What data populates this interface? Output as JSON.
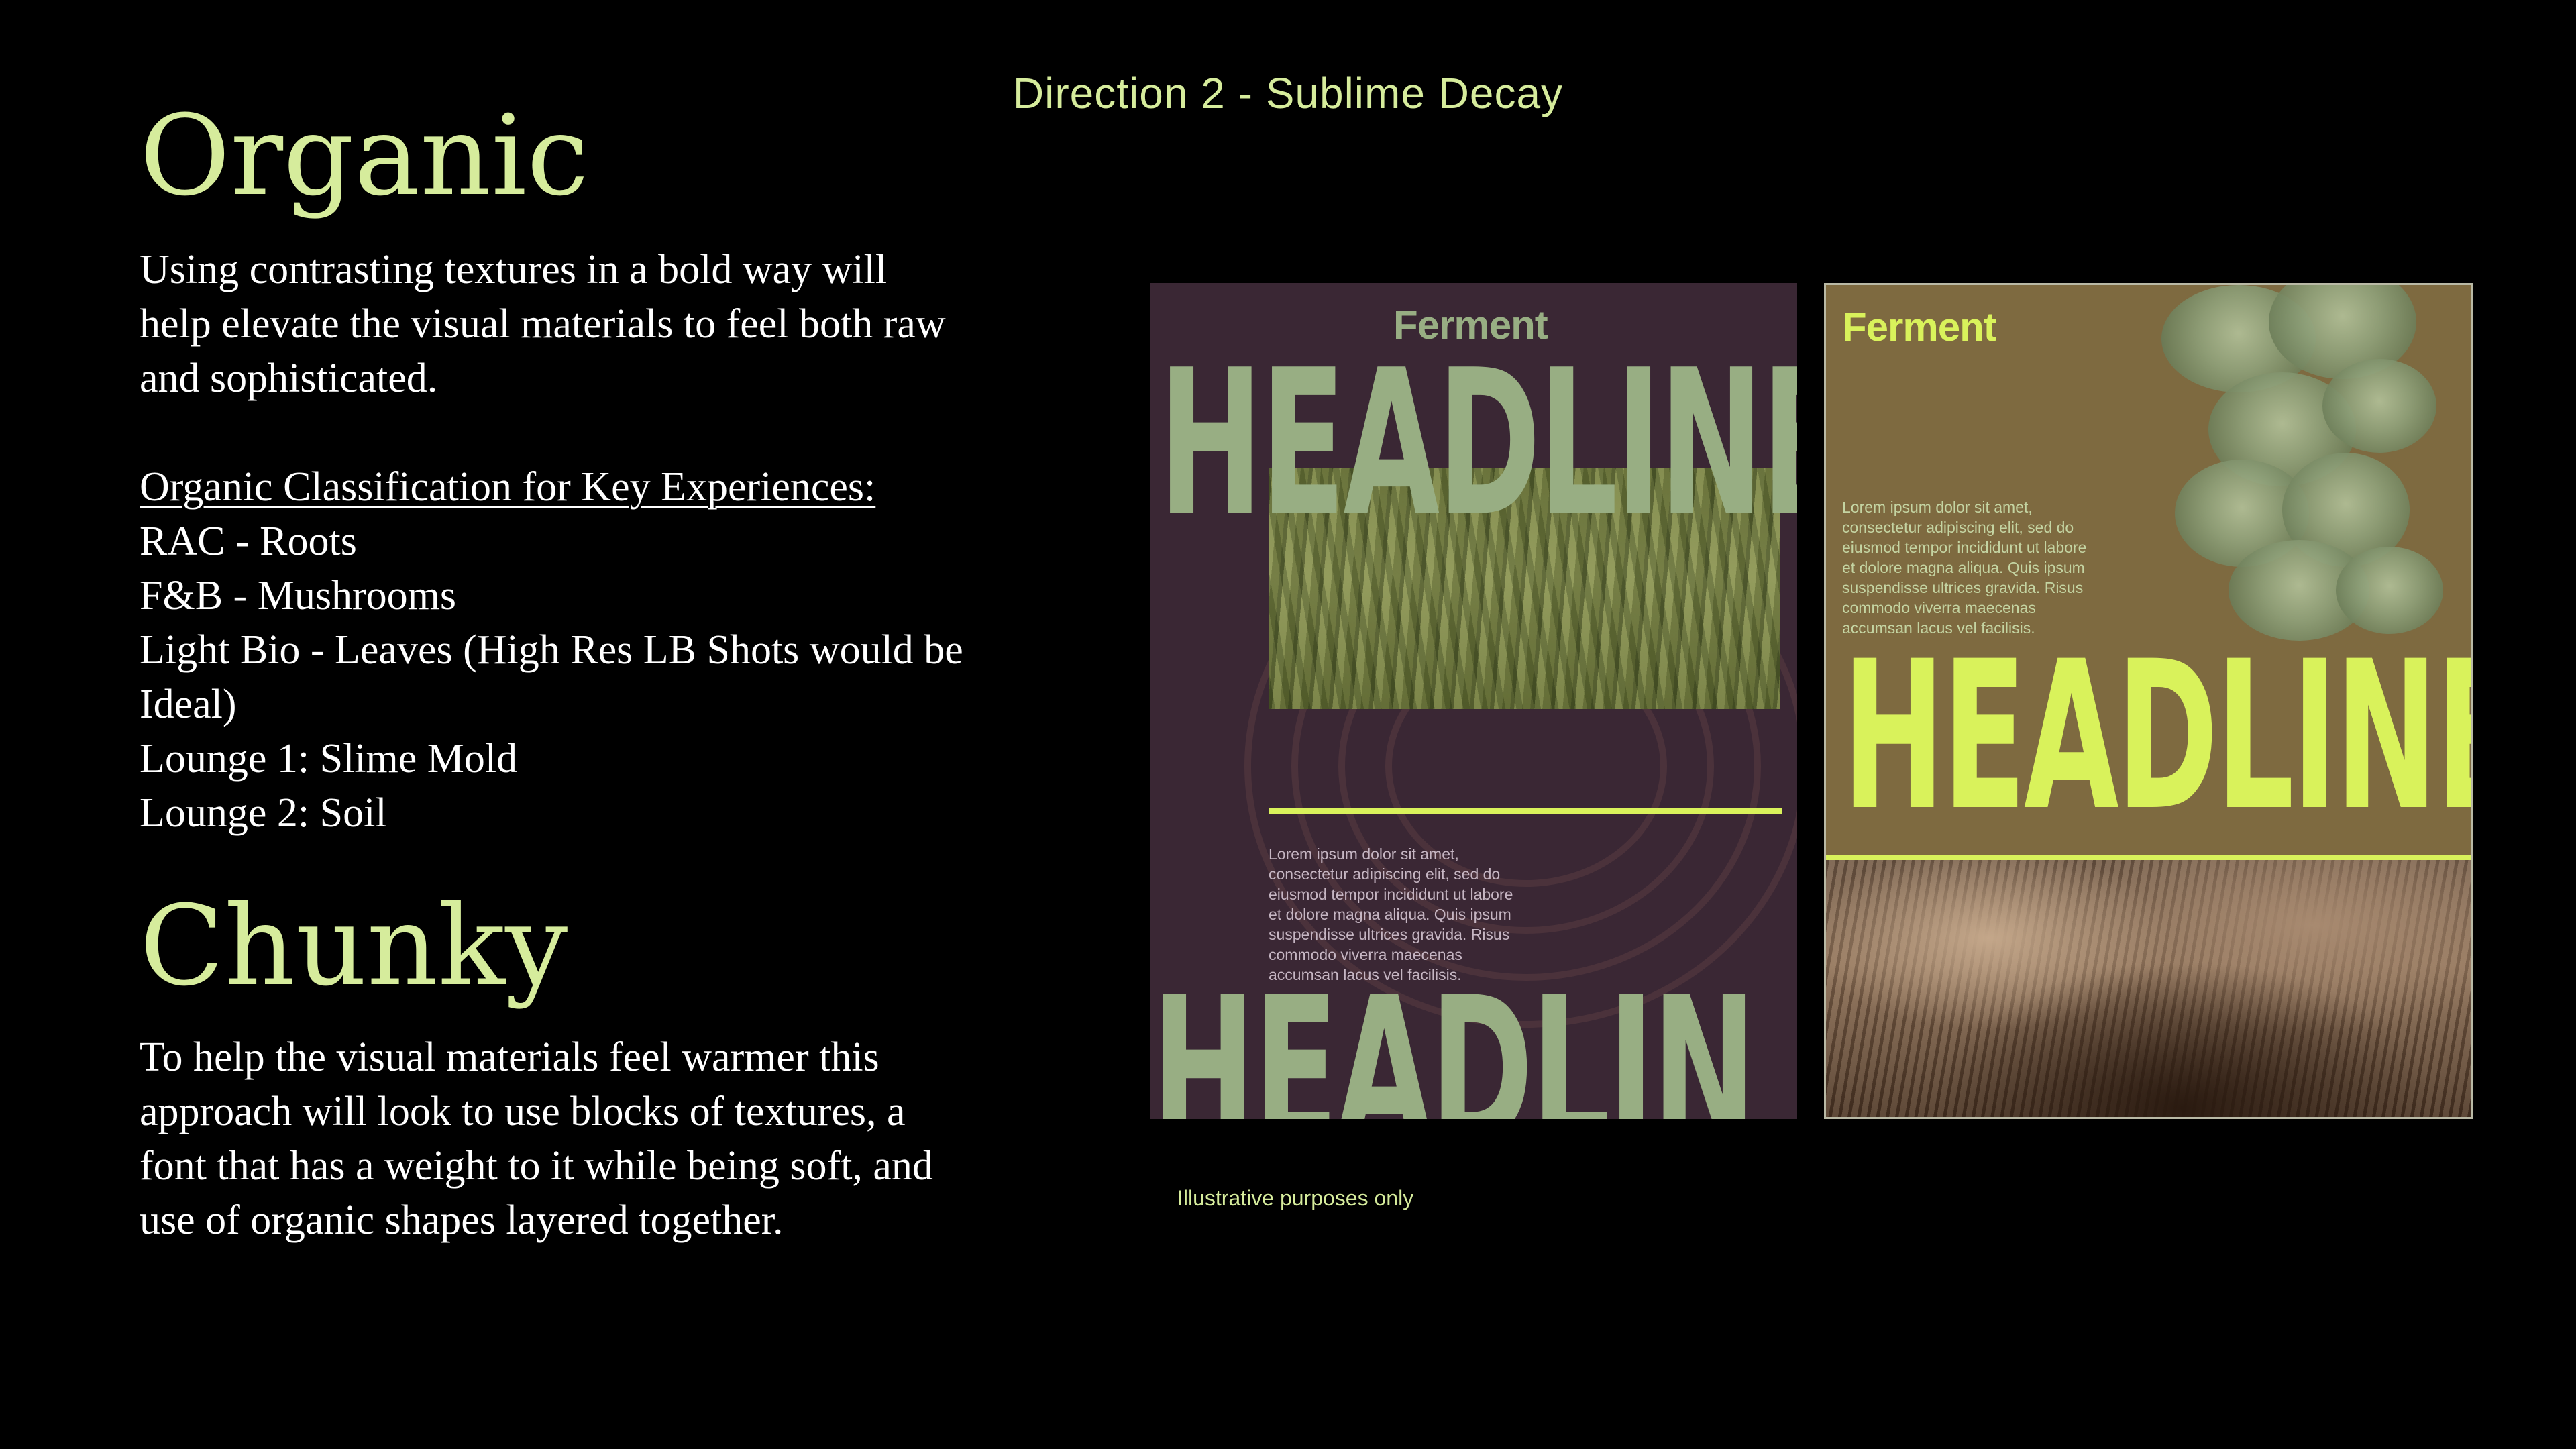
{
  "slide": {
    "direction_title": "Direction 2 - Sublime Decay"
  },
  "organic": {
    "heading": "Organic",
    "body": "Using contrasting textures in a bold way will help elevate the visual materials to feel both raw and sophisticated.",
    "classification": {
      "heading": "Organic Classification for Key Experiences:",
      "items": [
        "RAC - Roots",
        "F&B - Mushrooms",
        "Light Bio - Leaves (High Res LB Shots would be Ideal)",
        "Lounge 1: Slime Mold",
        "Lounge 2: Soil"
      ]
    }
  },
  "chunky": {
    "heading": "Chunky",
    "body": "To help the visual materials feel warmer this approach will look to use blocks of textures, a font that has a weight to it while being soft, and use of organic shapes layered together."
  },
  "poster_1": {
    "brand": "Ferment",
    "headline_top": "HEADLINE",
    "headline_bottom": "HEADLIN",
    "lorem": "Lorem ipsum dolor sit amet,\nconsectetur adipiscing elit, sed do\neiusmod tempor incididunt ut labore\net dolore magna aliqua. Quis ipsum\nsuspendisse ultrices gravida. Risus\ncommodo viverra maecenas\naccumsan lacus vel facilisis.",
    "colors": {
      "background": "#3a2734",
      "headline": "#98ae83",
      "accent": "#d9f25b"
    }
  },
  "poster_2": {
    "brand": "Ferment",
    "headline": "HEADLINE",
    "lorem": "Lorem ipsum dolor sit amet,\nconsectetur adipiscing elit, sed do\neiusmod tempor incididunt ut labore\net dolore magna aliqua. Quis ipsum\nsuspendisse ultrices gravida. Risus\ncommodo viverra maecenas\naccumsan lacus vel facilisis.",
    "colors": {
      "background": "#7e6a40",
      "headline": "#d9f25b"
    }
  },
  "caption": "Illustrative purposes only",
  "colors": {
    "background": "#000000",
    "heading_accent": "#d6ec9c",
    "body_text": "#ffffff"
  }
}
